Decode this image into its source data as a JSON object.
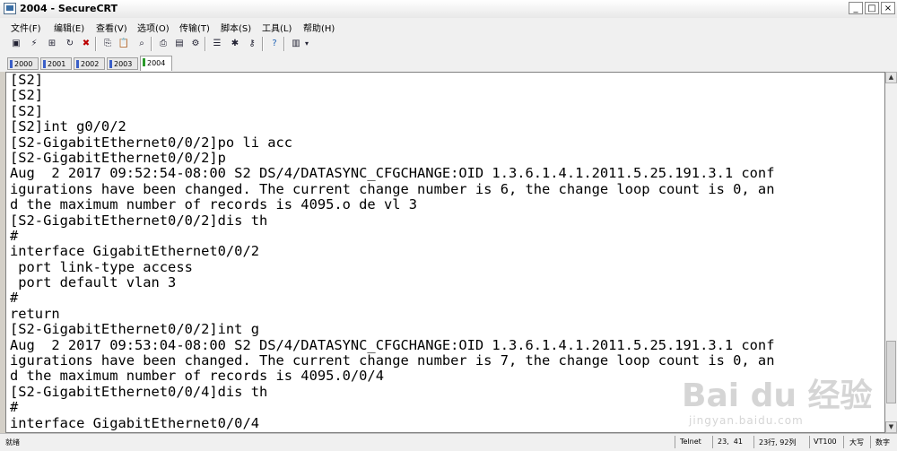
{
  "window": {
    "title": "2004 - SecureCRT",
    "app_icon": "securecrt-app-icon",
    "controls": [
      "minimize",
      "maximize",
      "close"
    ]
  },
  "menu": [
    "文件(F)",
    "编辑(E)",
    "查看(V)",
    "选项(O)",
    "传输(T)",
    "脚本(S)",
    "工具(L)",
    "帮助(H)"
  ],
  "toolbar": {
    "icons": [
      "connect-icon",
      "quick-connect-icon",
      "connect-in-tab-icon",
      "reconnect-icon",
      "disconnect-icon",
      "copy-icon",
      "paste-icon",
      "find-icon",
      "print-icon",
      "print-selection-icon",
      "print-setup-icon",
      "session-options-icon",
      "global-options-icon",
      "key-map-icon",
      "help-icon",
      "chat-window-icon"
    ]
  },
  "tabs": [
    {
      "label": "2000",
      "active": false
    },
    {
      "label": "2001",
      "active": false
    },
    {
      "label": "2002",
      "active": false
    },
    {
      "label": "2003",
      "active": false
    },
    {
      "label": "2004",
      "active": true
    }
  ],
  "terminal": {
    "lines": [
      "[S2]",
      "[S2]",
      "[S2]",
      "[S2]int g0/0/2",
      "[S2-GigabitEthernet0/0/2]po li acc",
      "[S2-GigabitEthernet0/0/2]p",
      "Aug  2 2017 09:52:54-08:00 S2 DS/4/DATASYNC_CFGCHANGE:OID 1.3.6.1.4.1.2011.5.25.191.3.1 conf",
      "igurations have been changed. The current change number is 6, the change loop count is 0, an",
      "d the maximum number of records is 4095.o de vl 3",
      "[S2-GigabitEthernet0/0/2]dis th",
      "#",
      "interface GigabitEthernet0/0/2",
      " port link-type access",
      " port default vlan 3",
      "#",
      "return",
      "[S2-GigabitEthernet0/0/2]int g",
      "Aug  2 2017 09:53:04-08:00 S2 DS/4/DATASYNC_CFGCHANGE:OID 1.3.6.1.4.1.2011.5.25.191.3.1 conf",
      "igurations have been changed. The current change number is 7, the change loop count is 0, an",
      "d the maximum number of records is 4095.0/0/4",
      "[S2-GigabitEthernet0/0/4]dis th",
      "#",
      "interface GigabitEthernet0/0/4"
    ]
  },
  "status": {
    "ready": "就绪",
    "protocol": "Telnet",
    "cursor": "23,  41",
    "rows_cols": "23行, 92列",
    "emulation": "VT100",
    "caps": "大写",
    "num": "数字"
  },
  "watermark": {
    "logo_text": "Bai du 经验",
    "url": "jingyan.baidu.com"
  }
}
